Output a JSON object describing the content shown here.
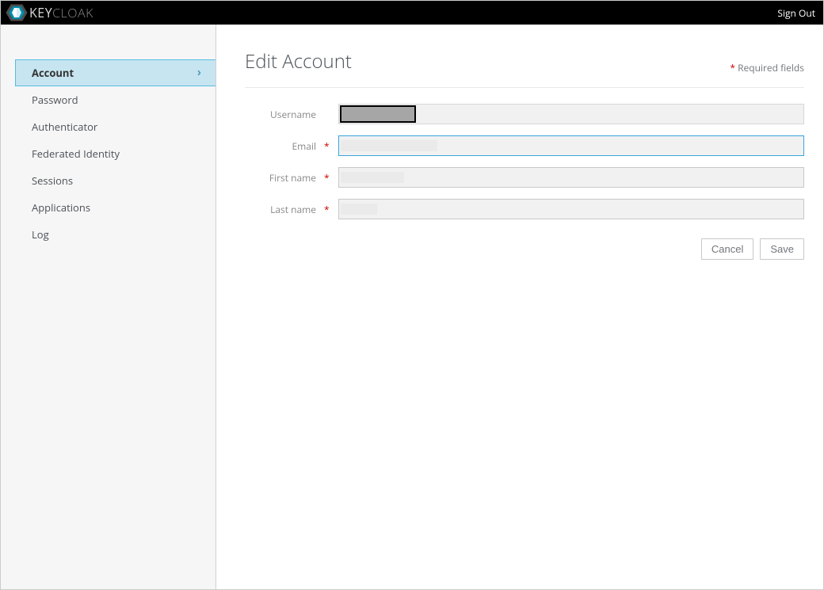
{
  "brand": {
    "key": "KEY",
    "cloak": "CLOAK"
  },
  "header": {
    "signout": "Sign Out"
  },
  "sidebar": {
    "items": [
      {
        "label": "Account",
        "active": true
      },
      {
        "label": "Password",
        "active": false
      },
      {
        "label": "Authenticator",
        "active": false
      },
      {
        "label": "Federated Identity",
        "active": false
      },
      {
        "label": "Sessions",
        "active": false
      },
      {
        "label": "Applications",
        "active": false
      },
      {
        "label": "Log",
        "active": false
      }
    ]
  },
  "page": {
    "title": "Edit Account",
    "required_note": "Required fields"
  },
  "form": {
    "username_label": "Username",
    "email_label": "Email",
    "firstname_label": "First name",
    "lastname_label": "Last name",
    "username_value": "",
    "email_value": "",
    "firstname_value": "",
    "lastname_value": ""
  },
  "actions": {
    "cancel": "Cancel",
    "save": "Save"
  }
}
